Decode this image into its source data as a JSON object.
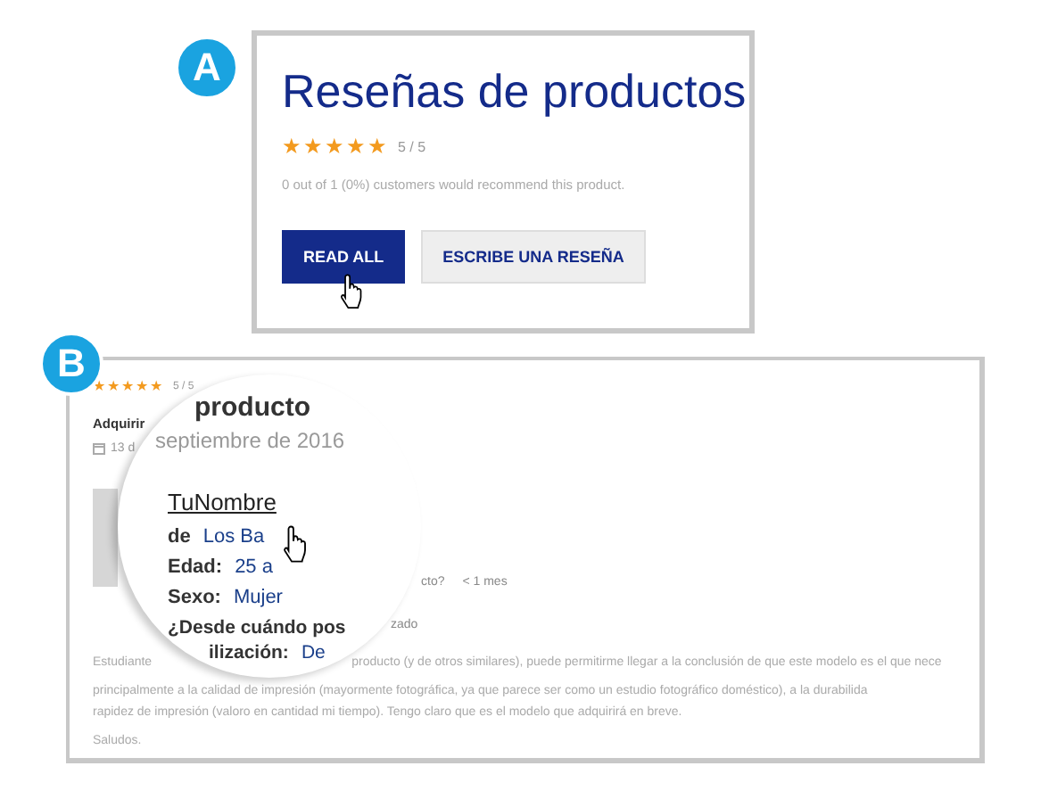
{
  "panel_a": {
    "badge": "A",
    "title": "Reseñas de productos",
    "stars": 5,
    "rating": "5 / 5",
    "recommendation": "0 out of 1 (0%) customers would recommend this product.",
    "buttons": [
      {
        "label": "READ ALL",
        "kind": "primary"
      },
      {
        "label": "ESCRIBE UNA RESEÑA",
        "kind": "secondary"
      }
    ]
  },
  "panel_b": {
    "badge": "B",
    "stars": 5,
    "rating": "5 / 5",
    "title_fragment": "Adquirir",
    "date_fragment": "13 d",
    "question_fragment": "cto?",
    "answer": "< 1 mes",
    "fragment": "zado",
    "paragraph_lines": [
      [
        "Estudiante",
        "producto (y de otros similares), puede permitirme llegar a la conclusión de que este modelo es el que nece"
      ],
      [
        "principalmente a la calidad de impresión (mayormente fotográfica, ya que parece ser como un estudio fotográfico doméstico), a la durabilida"
      ],
      [
        "rapidez de impresión (valoro en cantidad mi tiempo). Tengo claro que es el modelo que adquirirá en breve."
      ]
    ],
    "closing": "Saludos.",
    "magnifier": {
      "title": "producto",
      "date": "septiembre de 2016",
      "name": "TuNombre",
      "fields": [
        {
          "label": "de",
          "value": "Los Ba"
        },
        {
          "label": "Edad:",
          "value": "25 a"
        },
        {
          "label": "Sexo:",
          "value": "Mujer"
        },
        {
          "label": "¿Desde cuándo pos"
        },
        {
          "label": "ilización:",
          "value": "De"
        }
      ]
    }
  }
}
